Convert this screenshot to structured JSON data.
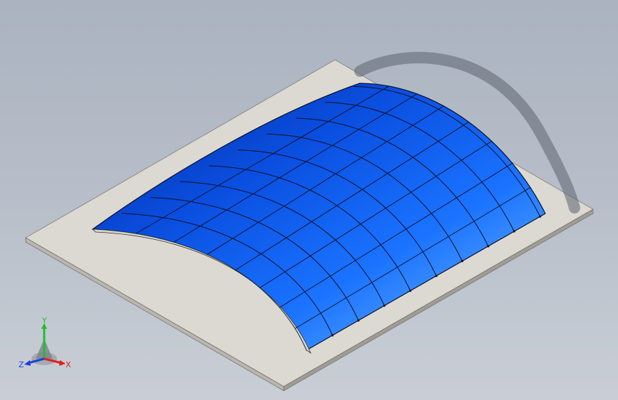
{
  "viewport": {
    "description_colors": {
      "background_top": "#aab3c0",
      "background_bottom": "#c9ced6",
      "base_plate": "#dedbd5",
      "base_plate_edge": "#8f8c86",
      "shell_dark": "#0a2a9a",
      "shell_mid": "#0b5ef0",
      "shell_light": "#6ab8ff",
      "grid_lines": "#0a0f2a"
    }
  },
  "triad": {
    "x_label": "X",
    "y_label": "Y",
    "z_label": "Z",
    "x_color": "#e0201a",
    "y_color": "#1fbf2c",
    "z_color": "#1f3fd8"
  }
}
